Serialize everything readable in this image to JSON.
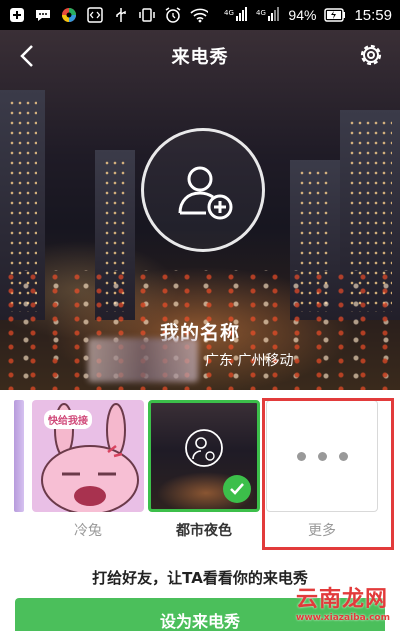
{
  "status_bar": {
    "battery_percent": "94%",
    "time": "15:59",
    "left_icons": [
      "add-icon",
      "chat-icon",
      "color-wheel-icon",
      "code-icon",
      "usb-icon",
      "vibrate-icon",
      "alarm-icon",
      "wifi-icon"
    ],
    "network_labels": [
      "4G",
      "4G"
    ]
  },
  "header": {
    "title": "来电秀",
    "back_icon": "back-arrow-icon",
    "settings_icon": "gear-icon"
  },
  "preview": {
    "caller_name": "我的名称",
    "location": "广东 广州移动",
    "avatar_icon": "add-contact-icon"
  },
  "themes": [
    {
      "label": "冷兔",
      "speech": "快给我接",
      "selected": false
    },
    {
      "label": "都市夜色",
      "selected": true
    },
    {
      "label": "更多",
      "selected": false
    }
  ],
  "hint_text": "打给好友，让TA看看你的来电秀",
  "cta_label": "设为来电秀",
  "watermark": {
    "text": "云南龙网",
    "sub": "www.xiazaiba.com"
  },
  "colors": {
    "accent_green": "#4bbf5b",
    "highlight_red": "#e23b3b"
  }
}
